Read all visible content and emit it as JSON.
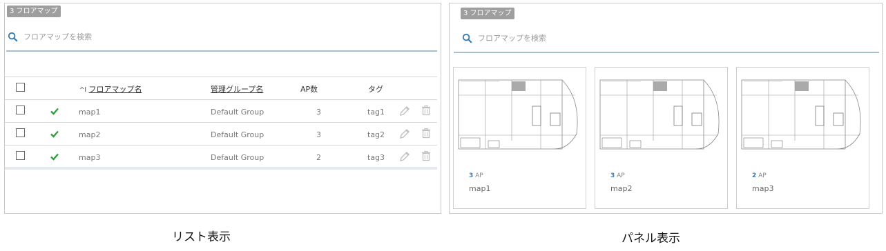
{
  "list_view": {
    "count_badge": "3 フロアマップ",
    "search_placeholder": "フロアマップを検索",
    "columns": {
      "sort_indicator": "^l",
      "name": "フロアマップ名",
      "group": "管理グループ名",
      "ap_count": "AP数",
      "tag": "タグ"
    },
    "rows": [
      {
        "name": "map1",
        "group": "Default Group",
        "ap_count": "3",
        "tag": "tag1"
      },
      {
        "name": "map2",
        "group": "Default Group",
        "ap_count": "3",
        "tag": "tag2"
      },
      {
        "name": "map3",
        "group": "Default Group",
        "ap_count": "2",
        "tag": "tag3"
      }
    ]
  },
  "panel_view": {
    "count_badge": "3 フロアマップ",
    "search_placeholder": "フロアマップを検索",
    "ap_unit": "AP",
    "cards": [
      {
        "ap_count": "3",
        "name": "map1"
      },
      {
        "ap_count": "3",
        "name": "map2"
      },
      {
        "ap_count": "2",
        "name": "map3"
      }
    ]
  },
  "captions": {
    "list": "リスト表示",
    "panel": "パネル表示"
  },
  "colors": {
    "accent_blue": "#3a78b5",
    "check_green": "#2e9e3e",
    "badge_gray": "#9e9e9e"
  },
  "icons": [
    "search-icon",
    "check-icon",
    "pencil-icon",
    "trash-icon"
  ]
}
